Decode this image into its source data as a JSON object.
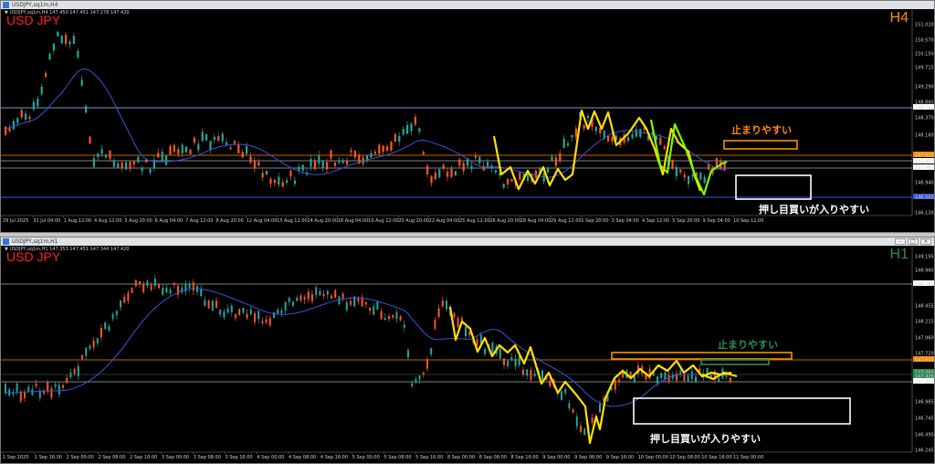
{
  "colors": {
    "bull": "#26a69a",
    "bear": "#ff5722",
    "ma": "#3a55d8",
    "wave": "#ffe000",
    "wave2": "#7cfc00",
    "orange": "#ff8c00",
    "green": "#4caf50",
    "white": "#ffffff"
  },
  "h4": {
    "window_title": "USDJPY,sq1m,H4",
    "info": "USDJPY,sq1m,H4  147.450 147.451 147.278 147.420",
    "symbol": "USD JPY",
    "timeframe": "H4",
    "timeframe_color": "#ff8c00",
    "y_labels": [
      "151.020",
      "150.570",
      "150.150",
      "149.715",
      "149.290",
      "148.860",
      "148.780",
      "148.370",
      "148.160",
      "147.633",
      "147.420",
      "147.287",
      "146.940",
      "146.565",
      "146.130"
    ],
    "x_labels": [
      "29 Jul 2025",
      "31 Jul 04:00",
      "1 Aug 12:00",
      "4 Aug 12:00",
      "5 Aug 20:00",
      "6 Aug 04:00",
      "7 Aug 12:00",
      "8 Aug 20:00",
      "12 Aug 04:00",
      "13 Aug 12:00",
      "14 Aug 20:00",
      "18 Aug 04:00",
      "19 Aug 12:00",
      "20 Aug 20:00",
      "22 Aug 04:00",
      "25 Aug 12:00",
      "26 Aug 20:00",
      "28 Aug 04:00",
      "29 Aug 12:00",
      "1 Sep 20:00",
      "3 Sep 04:00",
      "4 Sep 12:00",
      "5 Sep 20:00",
      "9 Sep 04:00",
      "10 Sep 12:00"
    ],
    "annotation_stop": "止まりやすい",
    "annotation_push": "押し目買いが入りやすい"
  },
  "h1": {
    "window_title": "USDJPY,sq1m,H1",
    "info": "USDJPY,sq1m,H1  147.353 147.451 147.344 147.420",
    "symbol": "USD JPY",
    "timeframe": "H1",
    "timeframe_color": "#2e8b57",
    "y_labels": [
      "149.195",
      "148.960",
      "148.780",
      "148.455",
      "148.215",
      "147.960",
      "147.720",
      "147.633",
      "147.464",
      "147.420",
      "147.287",
      "146.985",
      "146.745",
      "146.495",
      "146.245"
    ],
    "x_labels": [
      "1 Sep 2025",
      "1 Sep 16:00",
      "2 Sep 00:00",
      "2 Sep 08:00",
      "2 Sep 16:00",
      "3 Sep 00:00",
      "3 Sep 08:00",
      "3 Sep 16:00",
      "4 Sep 00:00",
      "4 Sep 08:00",
      "4 Sep 16:00",
      "5 Sep 00:00",
      "5 Sep 08:00",
      "5 Sep 16:00",
      "8 Sep 00:00",
      "8 Sep 08:00",
      "8 Sep 16:00",
      "9 Sep 00:00",
      "9 Sep 08:00",
      "9 Sep 16:00",
      "10 Sep 00:00",
      "10 Sep 08:00",
      "10 Sep 16:00",
      "11 Sep 00:00"
    ],
    "annotation_stop": "止まりやすい",
    "annotation_push": "押し目買いが入りやすい"
  }
}
